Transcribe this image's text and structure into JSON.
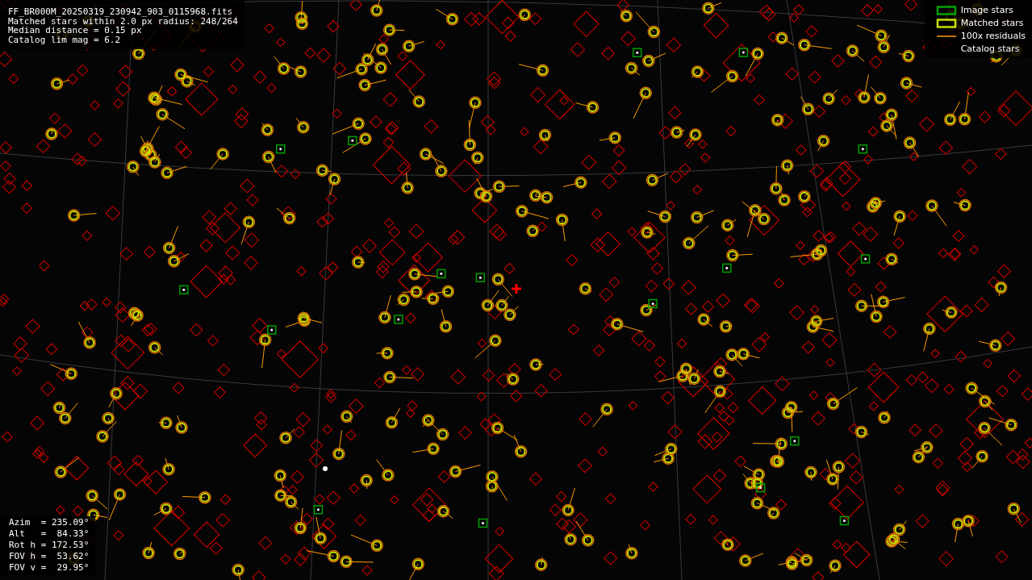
{
  "info_lines": [
    "FF_BR000M_20250319_230942_903_0115968.fits",
    "Matched stars within 2.0 px radius: 248/264",
    "Median distance = 0.15 px",
    "Catalog lim mag = 6.2"
  ],
  "legend": [
    {
      "kind": "image",
      "label": "Image stars"
    },
    {
      "kind": "matched",
      "label": "Matched stars"
    },
    {
      "kind": "residual",
      "label": "100x residuals"
    },
    {
      "kind": "catalog",
      "label": "Catalog stars"
    }
  ],
  "pointing": [
    "Azim  = 235.09°",
    "Alt   =  84.33°",
    "Rot h = 172.53°",
    "FOV h =  53.62°",
    "FOV v =  29.95°"
  ]
}
